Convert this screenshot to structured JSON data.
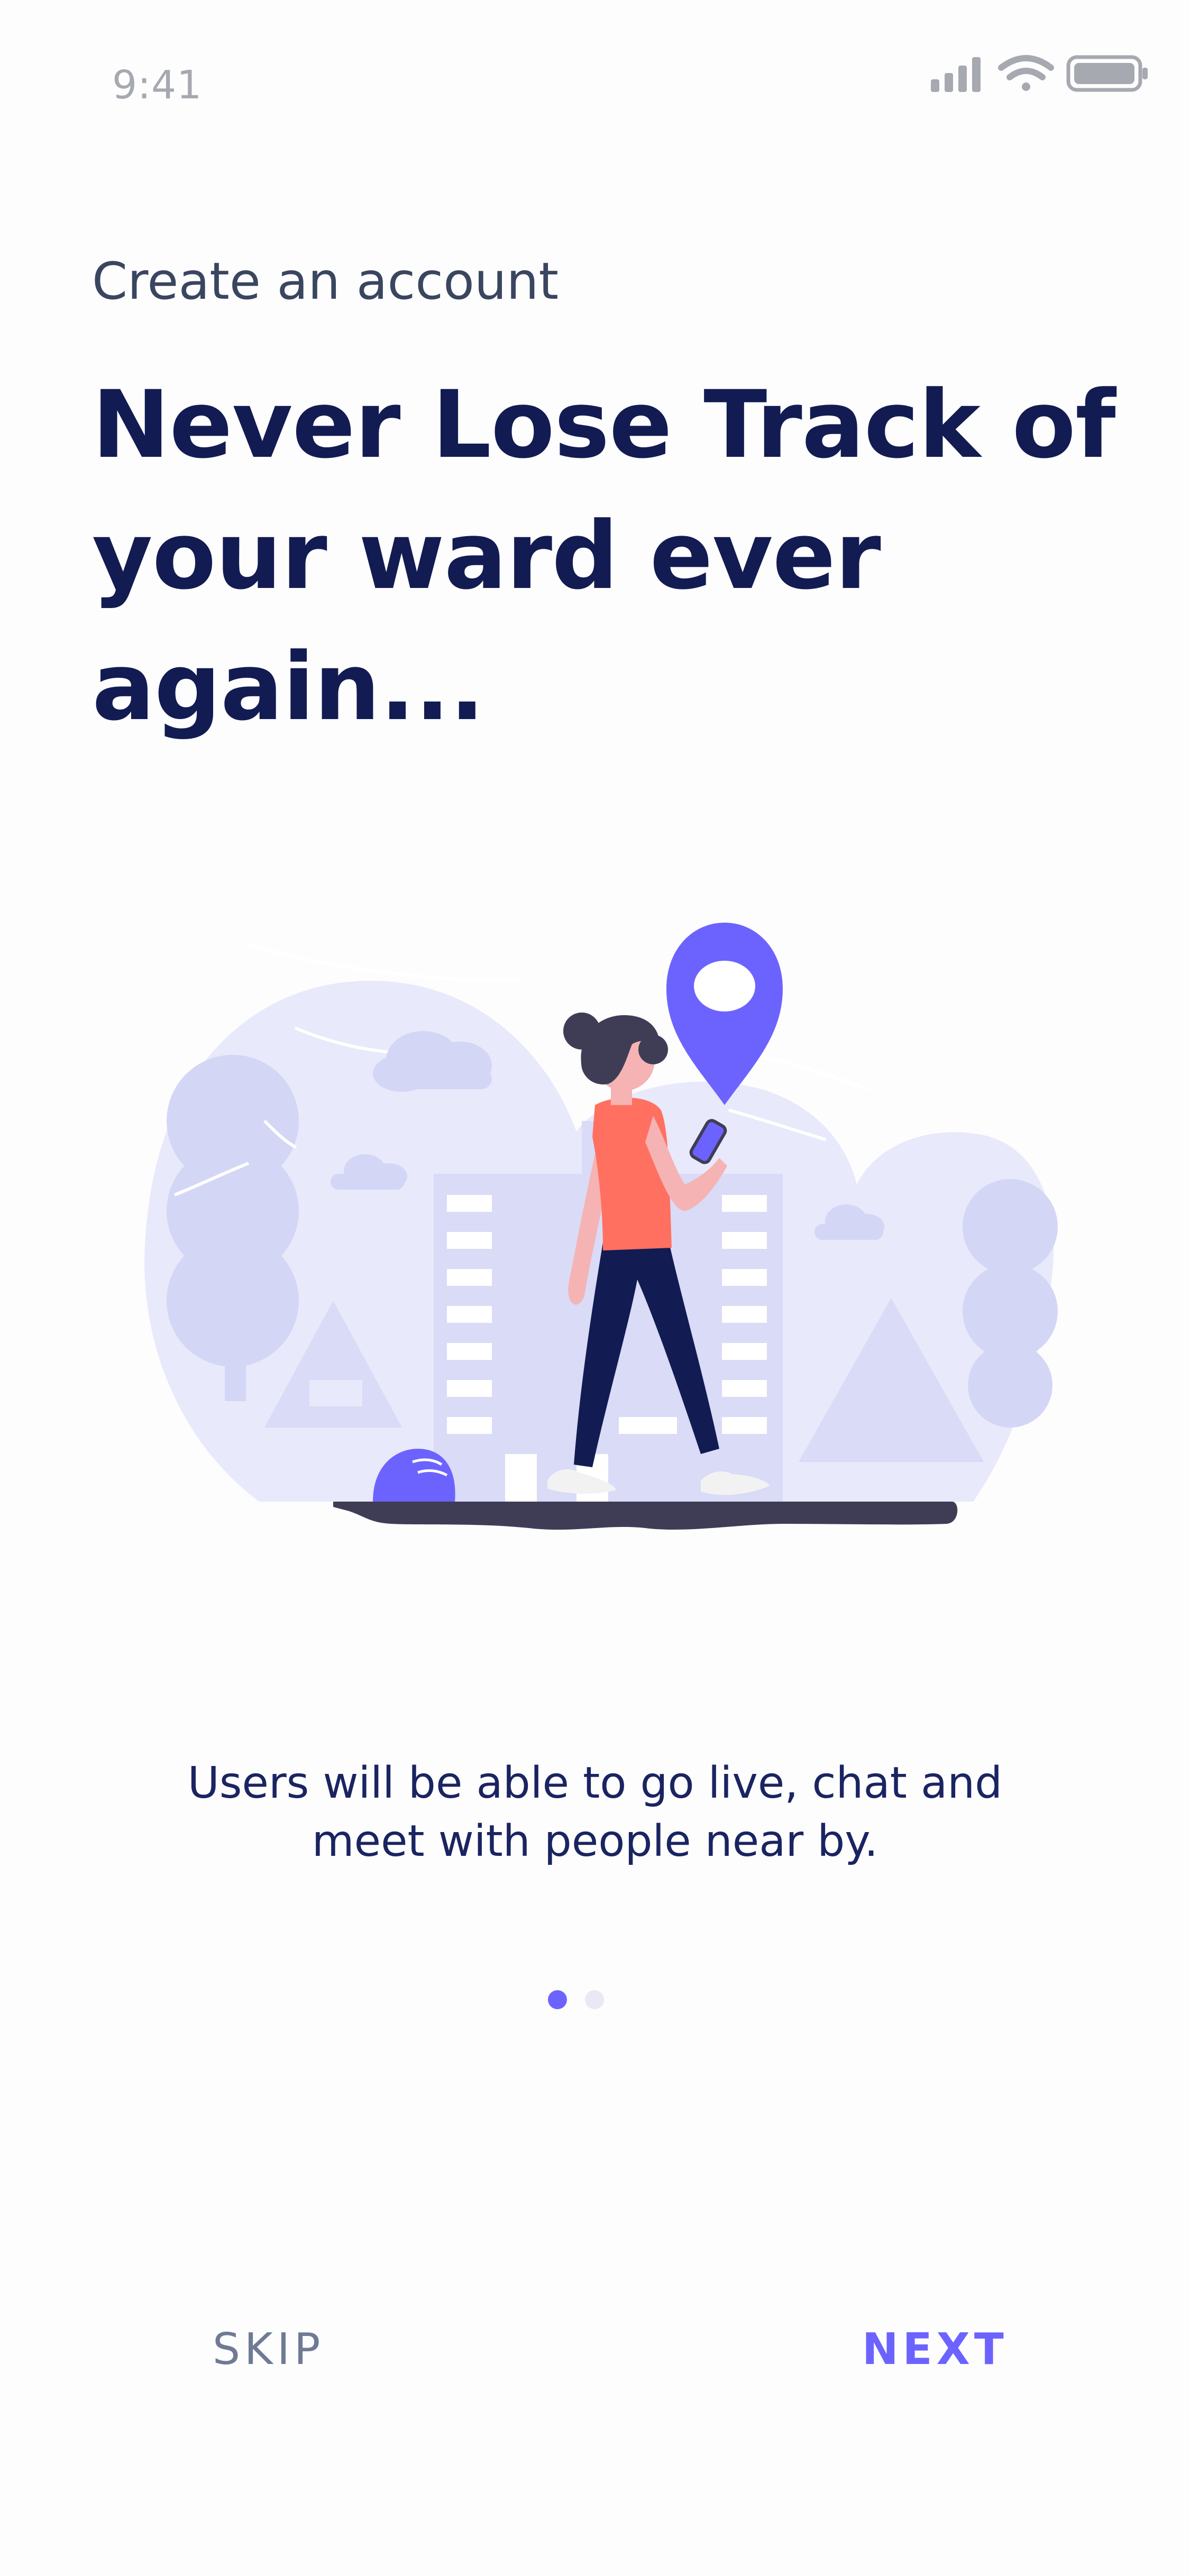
{
  "status_bar": {
    "time": "9:41"
  },
  "header": {
    "subtitle": "Create an account",
    "title": "Never Lose Track of your ward ever again..."
  },
  "illustration": {
    "subject": "woman-walking-with-phone",
    "icon": "location-pin-icon"
  },
  "body": {
    "description": "Users will be able to go live, chat and meet with people near by."
  },
  "pager": {
    "total": 2,
    "active_index": 0
  },
  "actions": {
    "skip_label": "SKIP",
    "next_label": "NEXT"
  },
  "colors": {
    "accent": "#6C63FF",
    "title": "#121C52",
    "text": "#1A2461",
    "muted": "#6F7A95",
    "dot_inactive": "#E6E6F5"
  }
}
